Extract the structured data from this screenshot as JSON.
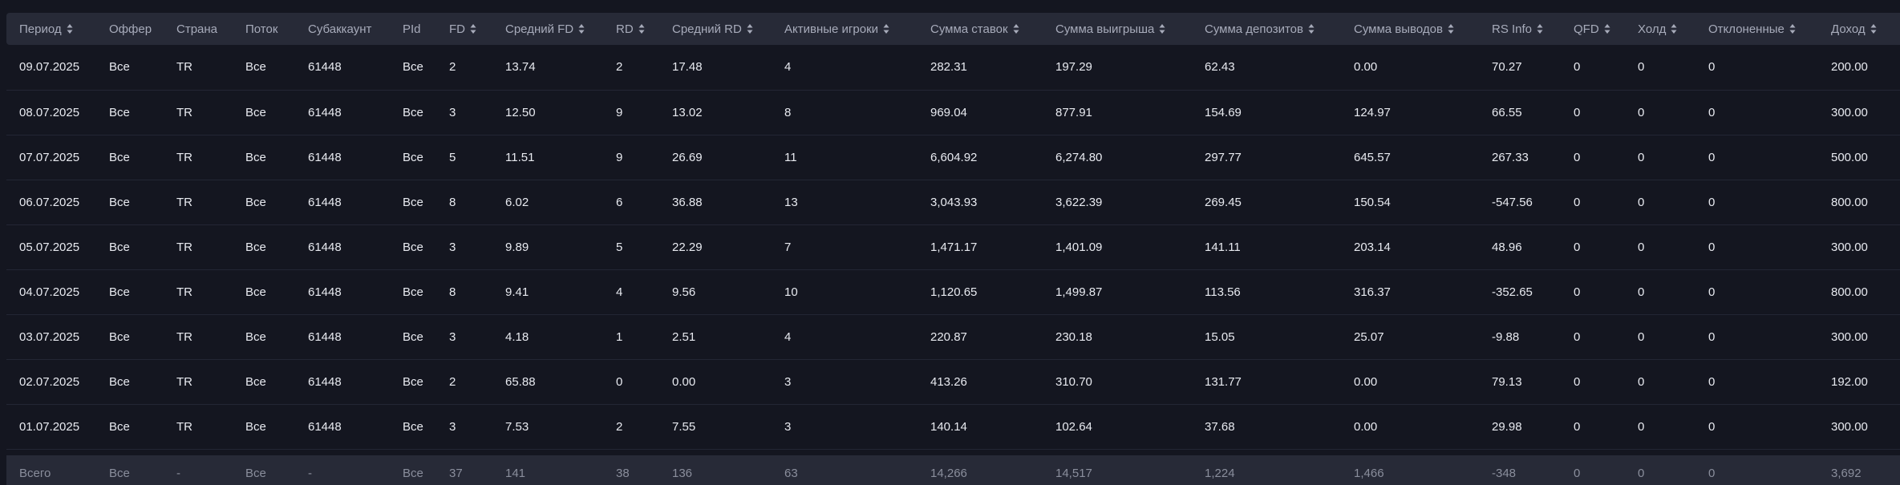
{
  "table": {
    "columns": [
      "Период",
      "Оффер",
      "Страна",
      "Поток",
      "Субаккаунт",
      "PId",
      "FD",
      "Средний FD",
      "RD",
      "Средний RD",
      "Активные игроки",
      "Сумма ставок",
      "Сумма выигрыша",
      "Сумма депозитов",
      "Сумма выводов",
      "RS Info",
      "QFD",
      "Холд",
      "Отклоненные",
      "Доход"
    ],
    "sortable": [
      true,
      false,
      false,
      false,
      false,
      false,
      true,
      true,
      true,
      true,
      true,
      true,
      true,
      true,
      true,
      true,
      true,
      true,
      true,
      true
    ],
    "rows": [
      [
        "09.07.2025",
        "Все",
        "TR",
        "Все",
        "61448",
        "Все",
        "2",
        "13.74",
        "2",
        "17.48",
        "4",
        "282.31",
        "197.29",
        "62.43",
        "0.00",
        "70.27",
        "0",
        "0",
        "0",
        "200.00"
      ],
      [
        "08.07.2025",
        "Все",
        "TR",
        "Все",
        "61448",
        "Все",
        "3",
        "12.50",
        "9",
        "13.02",
        "8",
        "969.04",
        "877.91",
        "154.69",
        "124.97",
        "66.55",
        "0",
        "0",
        "0",
        "300.00"
      ],
      [
        "07.07.2025",
        "Все",
        "TR",
        "Все",
        "61448",
        "Все",
        "5",
        "11.51",
        "9",
        "26.69",
        "11",
        "6,604.92",
        "6,274.80",
        "297.77",
        "645.57",
        "267.33",
        "0",
        "0",
        "0",
        "500.00"
      ],
      [
        "06.07.2025",
        "Все",
        "TR",
        "Все",
        "61448",
        "Все",
        "8",
        "6.02",
        "6",
        "36.88",
        "13",
        "3,043.93",
        "3,622.39",
        "269.45",
        "150.54",
        "-547.56",
        "0",
        "0",
        "0",
        "800.00"
      ],
      [
        "05.07.2025",
        "Все",
        "TR",
        "Все",
        "61448",
        "Все",
        "3",
        "9.89",
        "5",
        "22.29",
        "7",
        "1,471.17",
        "1,401.09",
        "141.11",
        "203.14",
        "48.96",
        "0",
        "0",
        "0",
        "300.00"
      ],
      [
        "04.07.2025",
        "Все",
        "TR",
        "Все",
        "61448",
        "Все",
        "8",
        "9.41",
        "4",
        "9.56",
        "10",
        "1,120.65",
        "1,499.87",
        "113.56",
        "316.37",
        "-352.65",
        "0",
        "0",
        "0",
        "800.00"
      ],
      [
        "03.07.2025",
        "Все",
        "TR",
        "Все",
        "61448",
        "Все",
        "3",
        "4.18",
        "1",
        "2.51",
        "4",
        "220.87",
        "230.18",
        "15.05",
        "25.07",
        "-9.88",
        "0",
        "0",
        "0",
        "300.00"
      ],
      [
        "02.07.2025",
        "Все",
        "TR",
        "Все",
        "61448",
        "Все",
        "2",
        "65.88",
        "0",
        "0.00",
        "3",
        "413.26",
        "310.70",
        "131.77",
        "0.00",
        "79.13",
        "0",
        "0",
        "0",
        "192.00"
      ],
      [
        "01.07.2025",
        "Все",
        "TR",
        "Все",
        "61448",
        "Все",
        "3",
        "7.53",
        "2",
        "7.55",
        "3",
        "140.14",
        "102.64",
        "37.68",
        "0.00",
        "29.98",
        "0",
        "0",
        "0",
        "300.00"
      ]
    ],
    "total": [
      "Всего",
      "Все",
      "-",
      "Все",
      "-",
      "Все",
      "37",
      "141",
      "38",
      "136",
      "63",
      "14,266",
      "14,517",
      "1,224",
      "1,466",
      "-348",
      "0",
      "0",
      "0",
      "3,692"
    ]
  },
  "colors": {
    "background": "#141620",
    "header_bg": "#272a37",
    "header_text": "#a7abba",
    "row_text": "#e8eaf0",
    "total_text": "#8a8e9c",
    "row_divider": "#232634"
  },
  "icons": {
    "sort": "sort-icon"
  }
}
